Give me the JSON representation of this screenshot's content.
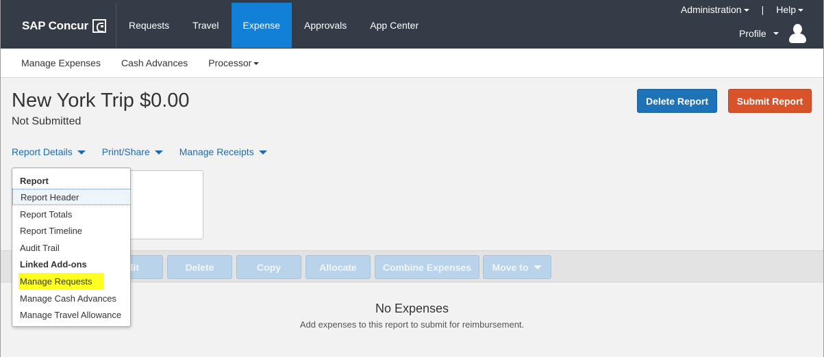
{
  "brand": {
    "name": "SAP Concur",
    "logo_icon": "concur-c-logo-icon"
  },
  "top_nav": [
    {
      "label": "Requests",
      "active": false
    },
    {
      "label": "Travel",
      "active": false
    },
    {
      "label": "Expense",
      "active": true
    },
    {
      "label": "Approvals",
      "active": false
    },
    {
      "label": "App Center",
      "active": false
    }
  ],
  "utility": {
    "administration": "Administration",
    "separator": "|",
    "help": "Help",
    "profile": "Profile",
    "avatar_icon": "user-avatar-icon"
  },
  "sub_nav": [
    {
      "label": "Manage Expenses"
    },
    {
      "label": "Cash Advances"
    },
    {
      "label": "Processor",
      "has_caret": true
    }
  ],
  "report": {
    "title": "New York Trip $0.00",
    "status": "Not Submitted",
    "delete_label": "Delete Report",
    "submit_label": "Submit Report"
  },
  "report_menus": [
    {
      "label": "Report Details"
    },
    {
      "label": "Print/Share"
    },
    {
      "label": "Manage Receipts"
    }
  ],
  "dropdown": {
    "items": [
      {
        "label": "Report",
        "type": "header"
      },
      {
        "label": "Report Header",
        "type": "item",
        "state": "hover"
      },
      {
        "label": "Report Totals",
        "type": "item"
      },
      {
        "label": "Report Timeline",
        "type": "item"
      },
      {
        "label": "Audit Trail",
        "type": "item"
      },
      {
        "label": "Linked Add-ons",
        "type": "header"
      },
      {
        "label": "Manage Requests",
        "type": "item",
        "state": "highlighted"
      },
      {
        "label": "Manage Cash Advances",
        "type": "item"
      },
      {
        "label": "Manage Travel Allowance",
        "type": "item"
      }
    ]
  },
  "toolbar": {
    "edit_fragment": "lit",
    "delete": "Delete",
    "copy": "Copy",
    "allocate": "Allocate",
    "combine": "Combine Expenses",
    "move_to": "Move to"
  },
  "empty_state": {
    "title": "No Expenses",
    "message": "Add expenses to this report to submit for reimbursement."
  },
  "colors": {
    "topbar": "#343c47",
    "active_nav": "#1380d7",
    "delete_button": "#1d72b8",
    "submit_button": "#d8532a",
    "link": "#1d6bb0",
    "highlight": "#ffff22"
  }
}
